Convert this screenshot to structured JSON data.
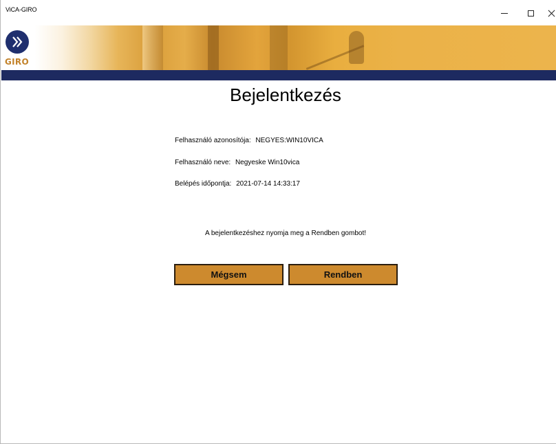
{
  "window": {
    "title": "ViCA-GIRO",
    "controls": {
      "minimize_icon": "minimize-icon",
      "maximize_icon": "maximize-icon",
      "close_icon": "close-icon"
    }
  },
  "banner": {
    "logo_text": "GIRO",
    "logo_icon": "double-chevron-right-icon",
    "colors": {
      "logo_circle": "#1f2f6e",
      "logo_text": "#c2822a",
      "stripe": "#1d2a60",
      "accent": "#ecb44c"
    }
  },
  "login": {
    "heading": "Bejelentkezés",
    "user_id_label": "Felhasználó azonosítója:",
    "user_id_value": "NEGYES:WIN10VICA",
    "user_name_label": "Felhasználó neve:",
    "user_name_value": "Negyeske Win10vica",
    "login_time_label": "Belépés időpontja:",
    "login_time_value": "2021-07-14 14:33:17",
    "instruction": "A bejelentkezéshez nyomja meg a Rendben gombot!",
    "cancel_label": "Mégsem",
    "ok_label": "Rendben",
    "button_color": "#cd8a2e"
  }
}
